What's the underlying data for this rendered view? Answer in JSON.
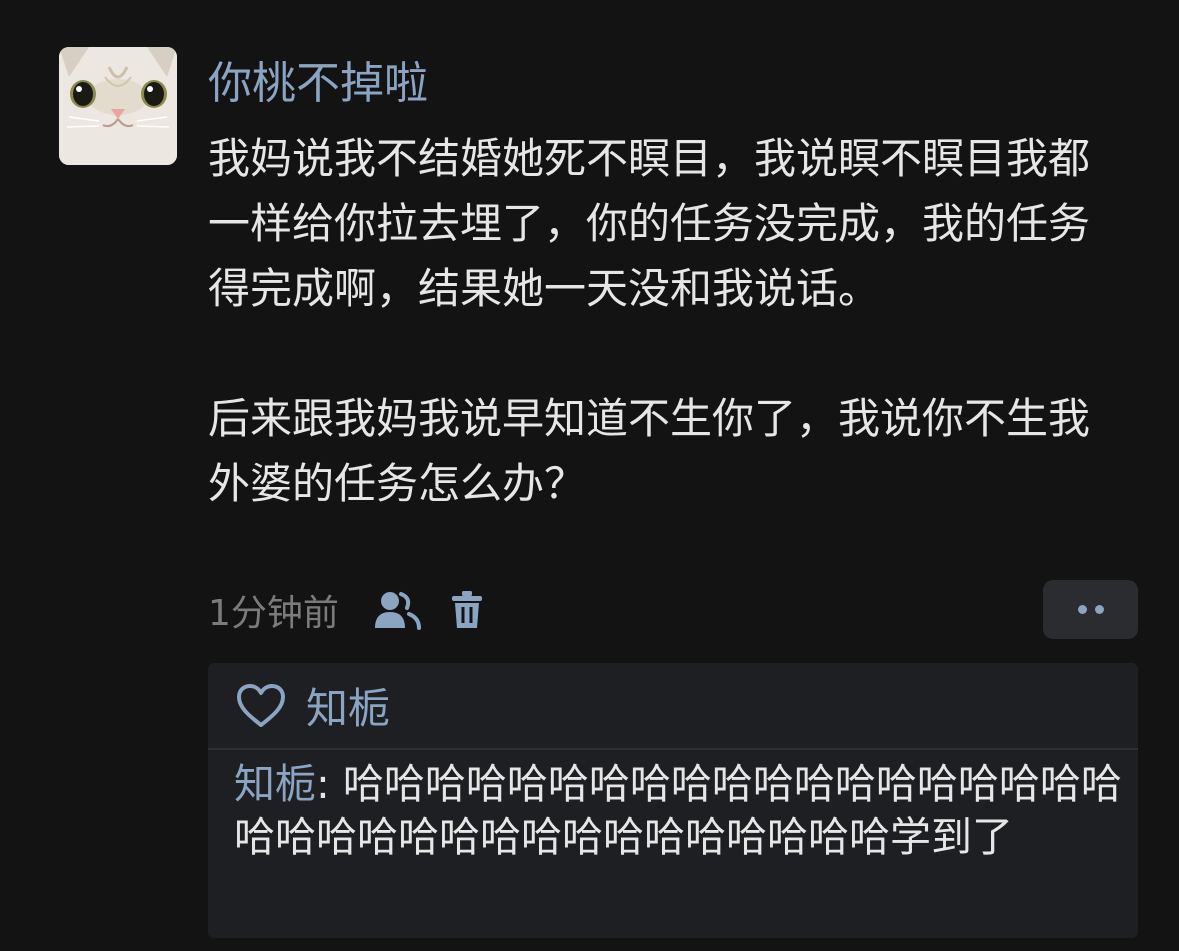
{
  "post": {
    "username": "你桃不掉啦",
    "paragraphs": [
      "我妈说我不结婚她死不瞑目，我说瞑不瞑目我都一样给你拉去埋了，你的任务没完成，我的任务得完成啊，结果她一天没和我说话。",
      "后来跟我妈我说早知道不生你了，我说你不生我外婆的任务怎么办？"
    ],
    "time": "1分钟前",
    "icons": {
      "user": "user-icon",
      "delete": "trash-icon",
      "more": "more-dots-icon"
    }
  },
  "reply_box": {
    "like_icon": "heart-icon",
    "liker": "知栀",
    "reply": {
      "author": "知栀",
      "separator": ": ",
      "text": "哈哈哈哈哈哈哈哈哈哈哈哈哈哈哈哈哈哈哈哈哈哈哈哈哈哈哈哈哈哈哈哈哈哈哈学到了"
    }
  },
  "colors": {
    "background": "#131313",
    "link": "#8aa4c2",
    "text": "#e6e6e6",
    "muted": "#7b7b7b",
    "panel": "#1e1f22"
  }
}
